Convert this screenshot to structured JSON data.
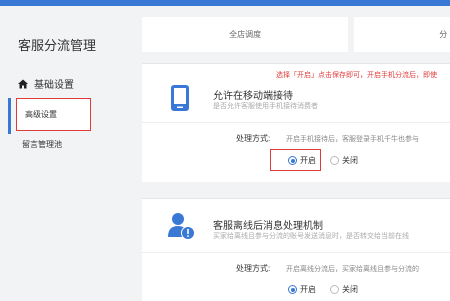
{
  "sidebar": {
    "title": "客服分流管理",
    "group_label": "基础设置",
    "items": [
      {
        "label": "高级设置",
        "active": true
      },
      {
        "label": "留言管理池",
        "active": false
      }
    ]
  },
  "tabs": [
    {
      "label": "全店调度"
    },
    {
      "label": "分"
    }
  ],
  "section_mobile": {
    "hint": "选择「开启」点击保存即可，开启手机分流后，即使",
    "title": "允许在移动端接待",
    "subtitle": "是否允许客服使用手机接待消费者",
    "process_label": "处理方式:",
    "process_desc": "开启手机接待后，客服登录手机千牛也参与",
    "options": [
      "开启",
      "关闭"
    ],
    "selected": "开启"
  },
  "section_offline": {
    "title": "客服离线后消息处理机制",
    "subtitle": "买家给离线且参与分流的账号发送消息时，是否转交给当前在线",
    "process_label": "处理方式:",
    "process_desc": "开启离线分流后，买家给离线且参与分流的",
    "options": [
      "开启",
      "关闭"
    ],
    "selected": "开启"
  },
  "colors": {
    "accent": "#3a78d6",
    "highlight": "#e03b3b"
  }
}
